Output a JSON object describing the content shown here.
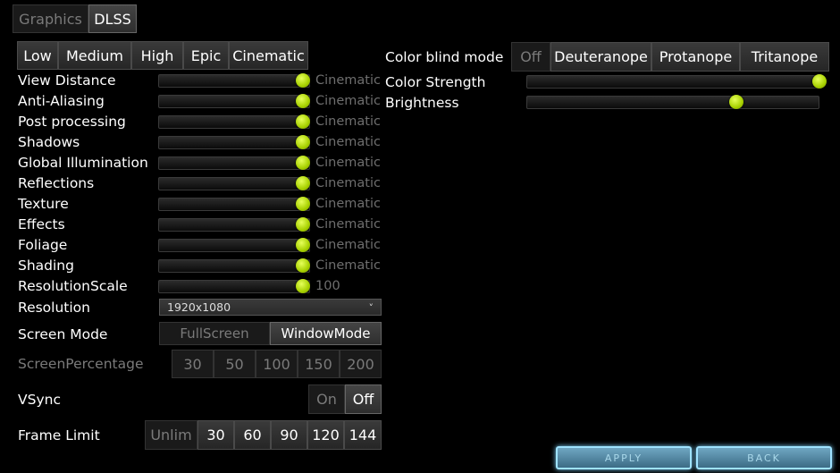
{
  "tabs": [
    {
      "label": "Graphics",
      "selected": false
    },
    {
      "label": "DLSS",
      "selected": true
    }
  ],
  "presets": [
    "Low",
    "Medium",
    "High",
    "Epic",
    "Cinematic"
  ],
  "quality_settings": [
    {
      "label": "View Distance",
      "value_text": "Cinematic",
      "level": 1.0
    },
    {
      "label": "Anti-Aliasing",
      "value_text": "Cinematic",
      "level": 1.0
    },
    {
      "label": "Post processing",
      "value_text": "Cinematic",
      "level": 1.0
    },
    {
      "label": "Shadows",
      "value_text": "Cinematic",
      "level": 1.0
    },
    {
      "label": "Global Illumination",
      "value_text": "Cinematic",
      "level": 1.0
    },
    {
      "label": "Reflections",
      "value_text": "Cinematic",
      "level": 1.0
    },
    {
      "label": "Texture",
      "value_text": "Cinematic",
      "level": 1.0
    },
    {
      "label": "Effects",
      "value_text": "Cinematic",
      "level": 1.0
    },
    {
      "label": "Foliage",
      "value_text": "Cinematic",
      "level": 1.0
    },
    {
      "label": "Shading",
      "value_text": "Cinematic",
      "level": 1.0
    },
    {
      "label": "ResolutionScale",
      "value_text": "100",
      "level": 1.0
    }
  ],
  "resolution": {
    "label": "Resolution",
    "value": "1920x1080",
    "arrow": "˅"
  },
  "screen_mode": {
    "label": "Screen Mode",
    "options": [
      "FullScreen",
      "WindowMode"
    ],
    "selected": "WindowMode"
  },
  "screen_percentage": {
    "label": "ScreenPercentage",
    "options": [
      "30",
      "50",
      "100",
      "150",
      "200"
    ]
  },
  "vsync": {
    "label": "VSync",
    "options": [
      "On",
      "Off"
    ],
    "selected": "Off"
  },
  "frame_limit": {
    "label": "Frame Limit",
    "options": [
      "Unlim",
      "30",
      "60",
      "90",
      "120",
      "144"
    ]
  },
  "color_blind": {
    "label": "Color blind mode",
    "options": [
      "Off",
      "Deuteranope",
      "Protanope",
      "Tritanope"
    ],
    "selected": "Off"
  },
  "color_strength": {
    "label": "Color Strength",
    "level": 1.0
  },
  "brightness": {
    "label": "Brightness",
    "level": 0.71
  },
  "footer": {
    "apply_label": "APPLY",
    "back_label": "BACK"
  },
  "colors": {
    "knob": "#a7d000",
    "glow": "#9fe3ff"
  }
}
